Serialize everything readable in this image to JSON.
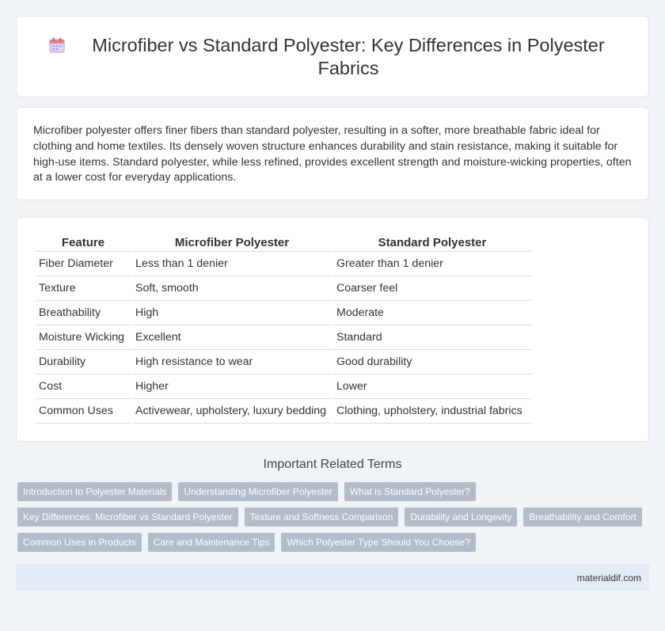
{
  "header": {
    "title": "Microfiber vs Standard Polyester: Key Differences in Polyester Fabrics",
    "icon": "calendar-icon"
  },
  "intro": {
    "text": "Microfiber polyester offers finer fibers than standard polyester, resulting in a softer, more breathable fabric ideal for clothing and home textiles. Its densely woven structure enhances durability and stain resistance, making it suitable for high-use items. Standard polyester, while less refined, provides excellent strength and moisture-wicking properties, often at a lower cost for everyday applications."
  },
  "table": {
    "headers": [
      "Feature",
      "Microfiber Polyester",
      "Standard Polyester"
    ],
    "rows": [
      [
        "Fiber Diameter",
        "Less than 1 denier",
        "Greater than 1 denier"
      ],
      [
        "Texture",
        "Soft, smooth",
        "Coarser feel"
      ],
      [
        "Breathability",
        "High",
        "Moderate"
      ],
      [
        "Moisture Wicking",
        "Excellent",
        "Standard"
      ],
      [
        "Durability",
        "High resistance to wear",
        "Good durability"
      ],
      [
        "Cost",
        "Higher",
        "Lower"
      ],
      [
        "Common Uses",
        "Activewear, upholstery, luxury bedding",
        "Clothing, upholstery, industrial fabrics"
      ]
    ]
  },
  "related": {
    "title": "Important Related Terms",
    "tags": [
      "Introduction to Polyester Materials",
      "Understanding Microfiber Polyester",
      "What is Standard Polyester?",
      "Key Differences: Microfiber vs Standard Polyester",
      "Texture and Softness Comparison",
      "Durability and Longevity",
      "Breathability and Comfort",
      "Common Uses in Products",
      "Care and Maintenance Tips",
      "Which Polyester Type Should You Choose?"
    ]
  },
  "footer": {
    "site": "materialdif.com"
  },
  "colors": {
    "background": "#f0f3f8",
    "tag": "#b3bcc8",
    "footer": "#e5ebf5"
  }
}
